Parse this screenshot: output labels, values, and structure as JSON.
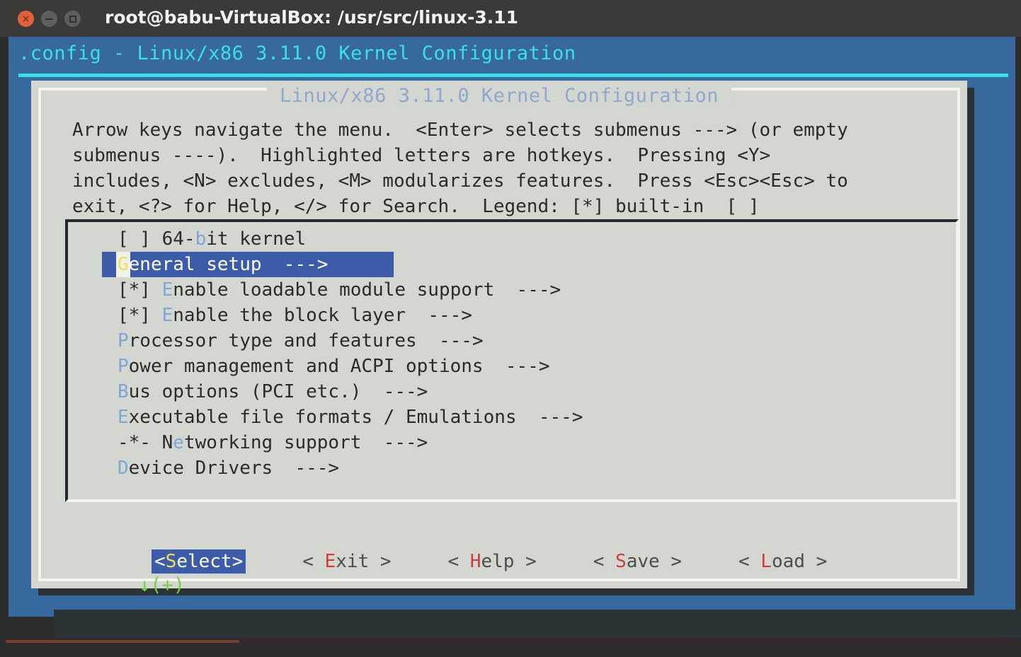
{
  "window": {
    "title": "root@babu-VirtualBox: /usr/src/linux-3.11",
    "controls": {
      "close": "×",
      "minimize": "",
      "maximize": ""
    }
  },
  "terminal": {
    "header": ".config - Linux/x86 3.11.0 Kernel Configuration"
  },
  "dialog": {
    "title": "Linux/x86 3.11.0 Kernel Configuration",
    "prompt_lines": [
      "Arrow keys navigate the menu.  <Enter> selects submenus ---> (or empty",
      "submenus ----).  Highlighted letters are hotkeys.  Pressing <Y>",
      "includes, <N> excludes, <M> modularizes features.  Press <Esc><Esc> to",
      "exit, <?> for Help, </> for Search.  Legend: [*] built-in  [ ]"
    ],
    "scroll_indicator": "↓(+)"
  },
  "menu": {
    "items": [
      {
        "tag": "[ ] ",
        "pre": "64-",
        "hotkey": "b",
        "post": "it kernel",
        "arrow": "",
        "selected": false
      },
      {
        "tag": "",
        "pre": "",
        "hotkey": "G",
        "post": "eneral setup",
        "arrow": "  --->",
        "selected": true
      },
      {
        "tag": "[*] ",
        "pre": "",
        "hotkey": "E",
        "post": "nable loadable module support",
        "arrow": "  --->",
        "selected": false
      },
      {
        "tag": "[*] ",
        "pre": "",
        "hotkey": "E",
        "post": "nable the block layer",
        "arrow": "  --->",
        "selected": false
      },
      {
        "tag": "",
        "pre": "",
        "hotkey": "P",
        "post": "rocessor type and features",
        "arrow": "  --->",
        "selected": false
      },
      {
        "tag": "",
        "pre": "",
        "hotkey": "P",
        "post": "ower management and ACPI options",
        "arrow": "  --->",
        "selected": false
      },
      {
        "tag": "",
        "pre": "",
        "hotkey": "B",
        "post": "us options (PCI etc.)",
        "arrow": "  --->",
        "selected": false
      },
      {
        "tag": "",
        "pre": "",
        "hotkey": "E",
        "post": "xecutable file formats / Emulations",
        "arrow": "  --->",
        "selected": false
      },
      {
        "tag": "-*- ",
        "pre": "N",
        "hotkey": "e",
        "post": "tworking support",
        "arrow": "  --->",
        "selected": false
      },
      {
        "tag": "",
        "pre": "",
        "hotkey": "D",
        "post": "evice Drivers",
        "arrow": "  --->",
        "selected": false
      }
    ]
  },
  "buttons": [
    {
      "left": "<",
      "pre": "",
      "hotkey": "S",
      "post": "elect",
      "right": ">",
      "active": true
    },
    {
      "left": "< ",
      "pre": "",
      "hotkey": "E",
      "post": "xit",
      "right": " >",
      "active": false
    },
    {
      "left": "< ",
      "pre": "",
      "hotkey": "H",
      "post": "elp",
      "right": " >",
      "active": false
    },
    {
      "left": "< ",
      "pre": "",
      "hotkey": "S",
      "post": "ave",
      "right": " >",
      "active": false
    },
    {
      "left": "< ",
      "pre": "",
      "hotkey": "L",
      "post": "oad",
      "right": " >",
      "active": false
    }
  ],
  "colors": {
    "terminal_bg": "#38699e",
    "header_cyan": "#3ae0e8",
    "dialog_bg": "#d3d7cf",
    "dialog_title": "#8fa8d0",
    "hotkey_blue": "#7ea6d8",
    "hotkey_yellow": "#f2e14c",
    "hotkey_red": "#cf3b39",
    "select_bg": "#3c5ba9",
    "scroll_green": "#73d44a",
    "titlebar_bg": "#3a3a38",
    "close_btn": "#e2613c"
  }
}
